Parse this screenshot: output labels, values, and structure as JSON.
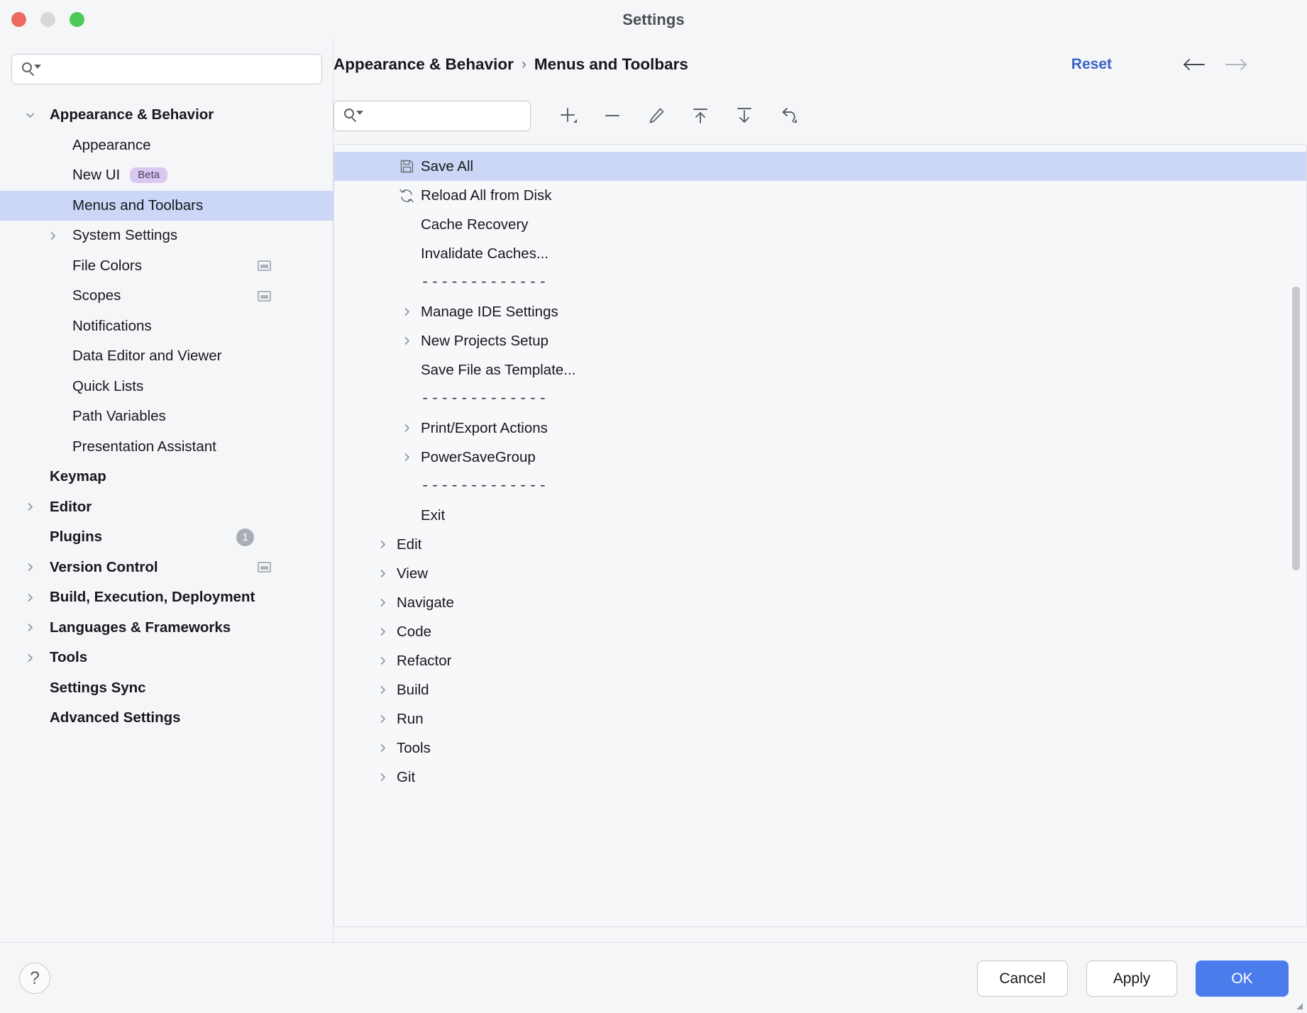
{
  "window": {
    "title": "Settings",
    "traffic_lights": [
      "close",
      "minimize",
      "zoom"
    ]
  },
  "sidebar": {
    "search": {
      "value": "",
      "placeholder": ""
    },
    "items": [
      {
        "label": "Appearance & Behavior",
        "level": 0,
        "group": true,
        "twisty": "down"
      },
      {
        "label": "Appearance",
        "level": 1
      },
      {
        "label": "New UI",
        "level": 1,
        "badge": "Beta"
      },
      {
        "label": "Menus and Toolbars",
        "level": 1,
        "selected": true
      },
      {
        "label": "System Settings",
        "level": 1,
        "twisty": "right"
      },
      {
        "label": "File Colors",
        "level": 1,
        "panel_icon": true
      },
      {
        "label": "Scopes",
        "level": 1,
        "panel_icon": true
      },
      {
        "label": "Notifications",
        "level": 1
      },
      {
        "label": "Data Editor and Viewer",
        "level": 1
      },
      {
        "label": "Quick Lists",
        "level": 1
      },
      {
        "label": "Path Variables",
        "level": 1
      },
      {
        "label": "Presentation Assistant",
        "level": 1
      },
      {
        "label": "Keymap",
        "level": 0,
        "group": true
      },
      {
        "label": "Editor",
        "level": 0,
        "group": true,
        "twisty": "right"
      },
      {
        "label": "Plugins",
        "level": 0,
        "group": true,
        "count": "1"
      },
      {
        "label": "Version Control",
        "level": 0,
        "group": true,
        "twisty": "right",
        "panel_icon": true
      },
      {
        "label": "Build, Execution, Deployment",
        "level": 0,
        "group": true,
        "twisty": "right"
      },
      {
        "label": "Languages & Frameworks",
        "level": 0,
        "group": true,
        "twisty": "right"
      },
      {
        "label": "Tools",
        "level": 0,
        "group": true,
        "twisty": "right"
      },
      {
        "label": "Settings Sync",
        "level": 0,
        "group": true
      },
      {
        "label": "Advanced Settings",
        "level": 0,
        "group": true
      }
    ]
  },
  "header": {
    "breadcrumb": [
      "Appearance & Behavior",
      "Menus and Toolbars"
    ],
    "breadcrumb_separator": "›",
    "reset_label": "Reset",
    "back_arrow": "back-arrow-icon",
    "forward_arrow": "forward-arrow-icon",
    "reset_color": "#3a62c8"
  },
  "toolbar": {
    "search": {
      "value": "",
      "placeholder": ""
    },
    "buttons": [
      {
        "name": "add-button",
        "icon": "plus-icon",
        "dropdown": true
      },
      {
        "name": "remove-button",
        "icon": "minus-icon",
        "dropdown": false
      },
      {
        "name": "edit-button",
        "icon": "pencil-icon",
        "dropdown": false
      },
      {
        "name": "move-up-button",
        "icon": "arrow-up-to-line-icon",
        "dropdown": false
      },
      {
        "name": "move-down-button",
        "icon": "arrow-down-to-line-icon",
        "dropdown": false
      },
      {
        "name": "restore-button",
        "icon": "revert-arrow-icon",
        "dropdown": true
      }
    ]
  },
  "menu_tree": {
    "separator_text": "-------------",
    "rows": [
      {
        "label": "Save All",
        "indent": 2,
        "icon": "floppy-disk-icon",
        "selected": true
      },
      {
        "label": "Reload All from Disk",
        "indent": 2,
        "icon": "refresh-icon"
      },
      {
        "label": "Cache Recovery",
        "indent": 2
      },
      {
        "label": "Invalidate Caches...",
        "indent": 2
      },
      {
        "type": "separator",
        "indent": 2
      },
      {
        "label": "Manage IDE Settings",
        "indent": 2,
        "chevron": true
      },
      {
        "label": "New Projects Setup",
        "indent": 2,
        "chevron": true
      },
      {
        "label": "Save File as Template...",
        "indent": 2
      },
      {
        "type": "separator",
        "indent": 2
      },
      {
        "label": "Print/Export Actions",
        "indent": 2,
        "chevron": true
      },
      {
        "label": "PowerSaveGroup",
        "indent": 2,
        "chevron": true
      },
      {
        "type": "separator",
        "indent": 2
      },
      {
        "label": "Exit",
        "indent": 2
      },
      {
        "label": "Edit",
        "indent": 1,
        "chevron": true
      },
      {
        "label": "View",
        "indent": 1,
        "chevron": true
      },
      {
        "label": "Navigate",
        "indent": 1,
        "chevron": true
      },
      {
        "label": "Code",
        "indent": 1,
        "chevron": true
      },
      {
        "label": "Refactor",
        "indent": 1,
        "chevron": true
      },
      {
        "label": "Build",
        "indent": 1,
        "chevron": true
      },
      {
        "label": "Run",
        "indent": 1,
        "chevron": true
      },
      {
        "label": "Tools",
        "indent": 1,
        "chevron": true
      },
      {
        "label": "Git",
        "indent": 1,
        "chevron": true
      }
    ]
  },
  "footer": {
    "help_glyph": "?",
    "cancel_label": "Cancel",
    "apply_label": "Apply",
    "ok_label": "OK",
    "ok_color": "#4a7ceb"
  }
}
